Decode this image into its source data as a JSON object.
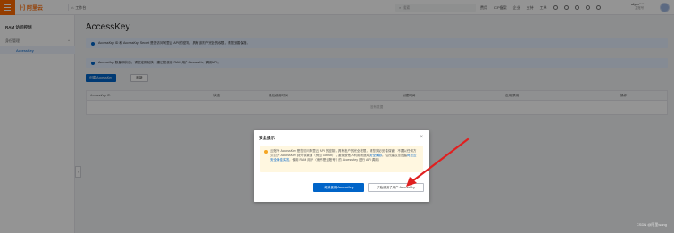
{
  "topbar": {
    "logo_text": "阿里云",
    "workspace": "工作台",
    "search_placeholder": "搜索",
    "links": [
      "费用",
      "ICP备案",
      "企业",
      "支持",
      "工单"
    ],
    "account_name": "aliyun****",
    "account_sub": "主账号"
  },
  "sidebar": {
    "title": "RAM 访问控制",
    "group": "身份管理",
    "active_item": "AccessKey"
  },
  "page": {
    "title": "AccessKey",
    "notice_1": "AccessKey ID 和 AccessKey Secret 是您访问阿里云 API 的密钥，具有该账户完全的权限，请您妥善保管。",
    "notice_2": "AccessKey 数量和状态，请您定期轮换，建议您使用 RAM 用户 AccessKey 调用API。",
    "create_button": "创建 AccessKey",
    "refresh_button": "刷新",
    "columns": [
      "AccessKey ID",
      "状态",
      "最后使用时间",
      "创建时间",
      "启用/禁用",
      "操作"
    ],
    "empty_text": "没有数据"
  },
  "dialog": {
    "title": "安全提示",
    "close": "×",
    "warning_text": "云账号 AccessKey 是您访问阿里云 API 的密钥，具有账户的完全权限，请您务必妥善保管！不要以任何方式公开 AccessKey 到外部渠道（例如 Github），避免被他人利用而造成",
    "warning_link_1": "安全威胁",
    "warning_text_2": "。强烈建议您遵循",
    "warning_link_2": "阿里云安全最佳实践",
    "warning_text_3": "，使用 RAM 用户（而不是云账号）的 AccessKey 进行 API 调用。",
    "continue_button": "继续使用 AccessKey",
    "subuser_button": "开始使用子用户 AccessKey"
  },
  "watermark": "CSDN @阿里wang",
  "colors": {
    "brand": "#ff6a00",
    "primary": "#0064c8",
    "arrow": "#e02020"
  }
}
